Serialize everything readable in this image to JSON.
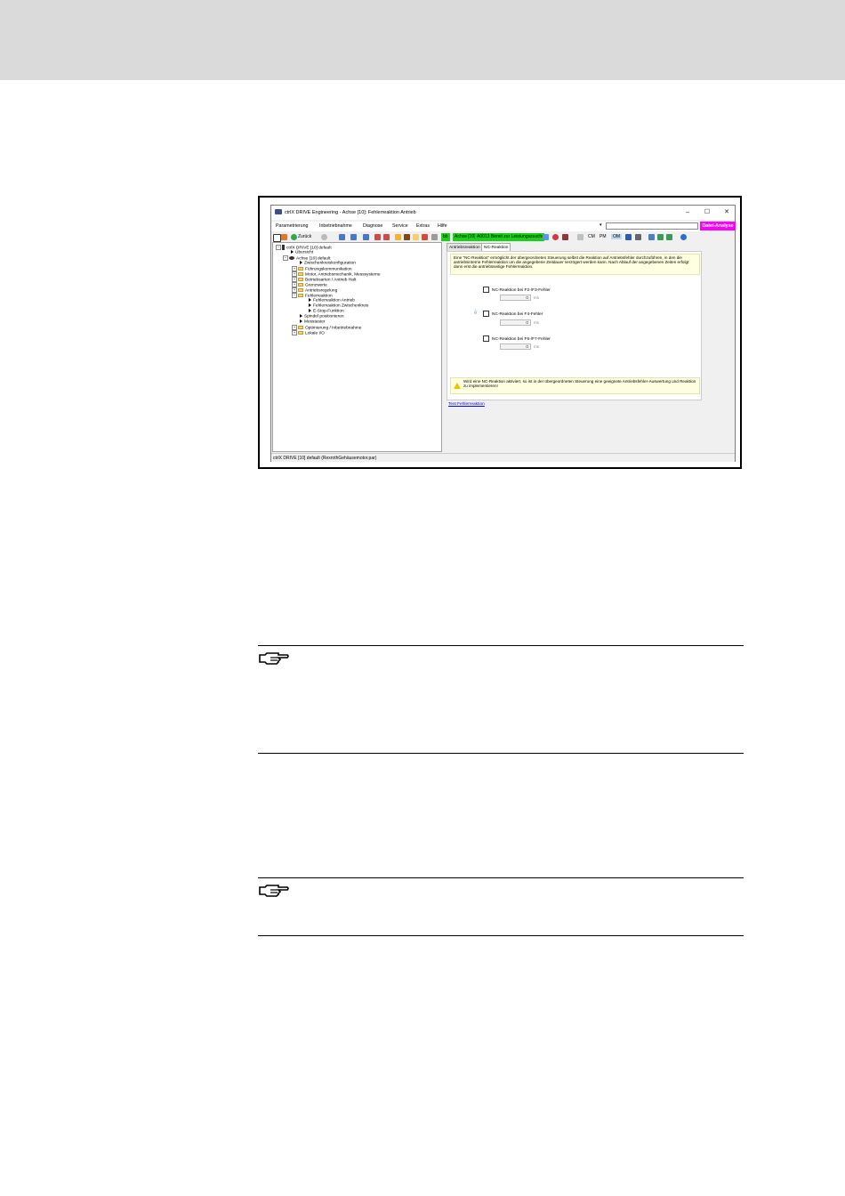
{
  "window": {
    "title": "ctrlX DRIVE Engineering - Achse [10]: Fehlerreaktion Antrieb",
    "minimize": "–",
    "maximize": "☐",
    "close": "✕"
  },
  "menu": {
    "items": [
      "Parametrierung",
      "Inbetriebnahme",
      "Diagnose",
      "Service",
      "Extras",
      "Hilfe"
    ],
    "search_arrow": "▾",
    "datei_analyse": "Datei-Analyse"
  },
  "toolbar": {
    "back_label": "Zurück",
    "status_bb": "bb",
    "status_axis": "Achse [10]:",
    "status_message": "A0013 Bereit zur Leistungszuschaltung",
    "mode_cm": "CM",
    "mode_pm": "PM",
    "mode_om": "OM"
  },
  "tree": {
    "items": [
      "ctrlX DRIVE [10] default",
      "Übersicht",
      "Achse [10] default",
      "Zwischenkreiskonfiguration",
      "Führungskommunikation",
      "Motor, Antriebsmechanik, Messsysteme",
      "Betriebsarten / Antrieb Halt",
      "Grenzwerte",
      "Antriebsregelung",
      "Fehlerreaktion",
      "Fehlerreaktion Antrieb",
      "Fehlerreaktion Zwischenkreis",
      "E-Stop-Funktion",
      "Spindel positionieren",
      "Messtaster",
      "Optimierung / Inbetriebnahme",
      "Lokale I/O"
    ]
  },
  "tabs": [
    "Antriebsreaktion",
    "NC-Reaktion"
  ],
  "content": {
    "info_text": "Eine \"NC-Reaktion\" ermöglicht der übergeordneten Steuerung selbst die Reaktion auf Antriebsfehler durchzuführen, in den die antriebsinterne Fehlerreaktion um die angegebene Zeitdauer verzögert werden kann. Nach Ablauf der angegebenen Zeiten erfolgt dann erst die antriebsseitige Fehlerreaktion.",
    "rows": [
      {
        "label": "NC-Reaktion bei F2-/F3-Fehler",
        "value": "0",
        "unit": "ms"
      },
      {
        "label": "NC-Reaktion bei F4-Fehler",
        "value": "0",
        "unit": "ms"
      },
      {
        "label": "NC-Reaktion bei F6-/F7-Fehler",
        "value": "0",
        "unit": "ms"
      }
    ],
    "warning_text": "Wird eine NC-Reaktion aktiviert, so ist in der übergeordneten Steuerung eine geeignete Antriebsfehler-Auswertung und Reaktion zu implementieren!",
    "link": "Test Fehlerreaktion"
  },
  "statusbar": "ctrlX DRIVE [10] default (RexrothGehäusemotor.par)",
  "colors": {
    "status_green": "#19d119",
    "datei_analyse": "#ff00ff",
    "info_background": "#ffffe1",
    "header_band": "#dadada"
  },
  "icons": [
    "hand-pointer-icon",
    "warning-icon"
  ]
}
